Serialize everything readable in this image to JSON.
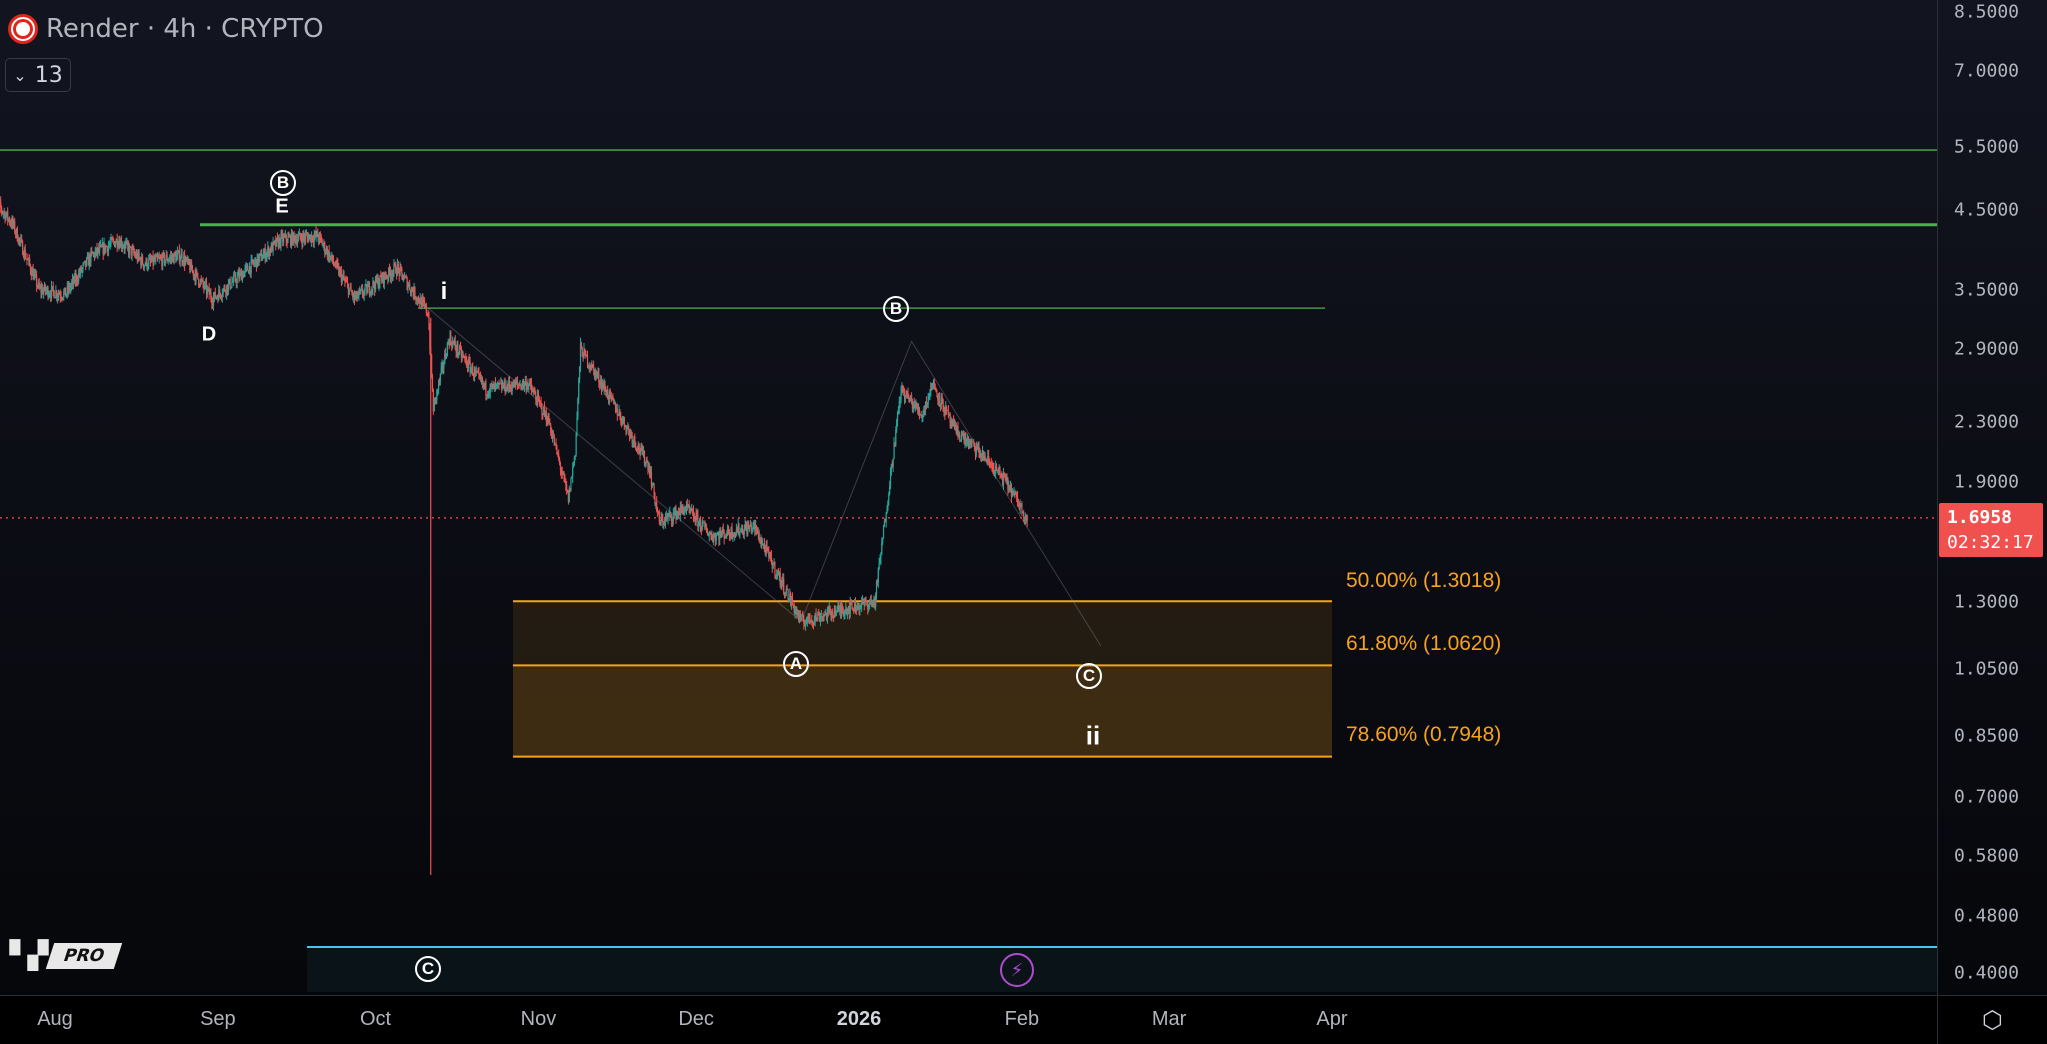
{
  "header": {
    "symbol": "Render",
    "interval": "4h",
    "exchange": "CRYPTO",
    "title": "Render · 4h · CRYPTO",
    "indicator_count": "13"
  },
  "price": {
    "last": "1.6958",
    "countdown": "02:32:17",
    "last_value": 1.6958
  },
  "price_axis": {
    "ticks": [
      "8.5000",
      "7.0000",
      "5.5000",
      "4.5000",
      "3.5000",
      "2.9000",
      "2.3000",
      "1.9000",
      "1.3000",
      "1.0500",
      "0.8500",
      "0.7000",
      "0.5800",
      "0.4800",
      "0.4000"
    ],
    "range": [
      0.4,
      8.5
    ],
    "scale": "log"
  },
  "time_axis": {
    "labels": [
      {
        "text": "Aug",
        "day": 0
      },
      {
        "text": "Sep",
        "day": 31
      },
      {
        "text": "Oct",
        "day": 61
      },
      {
        "text": "Nov",
        "day": 92
      },
      {
        "text": "Dec",
        "day": 122
      },
      {
        "text": "2026",
        "day": 153,
        "bold": true
      },
      {
        "text": "Feb",
        "day": 184
      },
      {
        "text": "Mar",
        "day": 212
      },
      {
        "text": "Apr",
        "day": 243
      }
    ]
  },
  "chart_data": {
    "type": "candlestick",
    "title": "Render · 4h · CRYPTO",
    "x_unit": "days since 2025-08-01",
    "price_path": [
      [
        -12,
        4.7
      ],
      [
        -8,
        4.3
      ],
      [
        -3,
        3.5
      ],
      [
        2,
        3.45
      ],
      [
        7,
        3.9
      ],
      [
        12,
        4.1
      ],
      [
        17,
        3.8
      ],
      [
        24,
        3.9
      ],
      [
        30,
        3.4
      ],
      [
        36,
        3.7
      ],
      [
        43,
        4.1
      ],
      [
        50,
        4.15
      ],
      [
        57,
        3.4
      ],
      [
        65,
        3.75
      ],
      [
        71,
        3.25
      ],
      [
        72,
        2.4
      ],
      [
        75,
        3.0
      ],
      [
        82,
        2.55
      ],
      [
        90,
        2.6
      ],
      [
        94,
        2.3
      ],
      [
        97.7,
        1.8
      ],
      [
        99,
        2.1
      ],
      [
        100,
        2.9
      ],
      [
        104,
        2.6
      ],
      [
        113,
        2.0
      ],
      [
        115,
        1.67
      ],
      [
        120,
        1.75
      ],
      [
        125,
        1.6
      ],
      [
        133,
        1.65
      ],
      [
        142,
        1.22
      ],
      [
        150,
        1.27
      ],
      [
        156,
        1.3
      ],
      [
        158,
        1.7
      ],
      [
        161,
        2.55
      ],
      [
        165,
        2.35
      ],
      [
        167,
        2.6
      ],
      [
        171,
        2.25
      ],
      [
        177,
        2.05
      ],
      [
        181,
        1.9
      ],
      [
        185,
        1.6958
      ]
    ],
    "crash_wick": {
      "day": 71.5,
      "low": 0.546
    },
    "colors": {
      "up": "#26a69a",
      "down": "#ef5350"
    }
  },
  "levels": {
    "horizontal": [
      {
        "price": 5.45,
        "color": "#4caf50"
      },
      {
        "price": 4.3,
        "color": "#4caf50"
      },
      {
        "price": 3.3,
        "color": "#4caf50"
      }
    ]
  },
  "fibonacci": [
    {
      "label": "50.00% (1.3018)",
      "price": 1.3018
    },
    {
      "label": "61.80% (1.0620)",
      "price": 1.062
    },
    {
      "label": "78.60% (0.7948)",
      "price": 0.7948
    }
  ],
  "fib_color": "#f7a21b",
  "wave_labels": {
    "circled_b_top": "B",
    "e": "E",
    "d": "D",
    "i": "i",
    "circled_b": "B",
    "circled_a": "A",
    "circled_c": "C",
    "ii": "ii",
    "panel_c": "C"
  },
  "wave_path": [
    [
      71,
      3.3
    ],
    [
      142,
      1.22
    ],
    [
      163,
      2.97
    ],
    [
      199,
      1.13
    ]
  ],
  "branding": {
    "logo_mark": "17",
    "logo_tier": "PRO"
  }
}
